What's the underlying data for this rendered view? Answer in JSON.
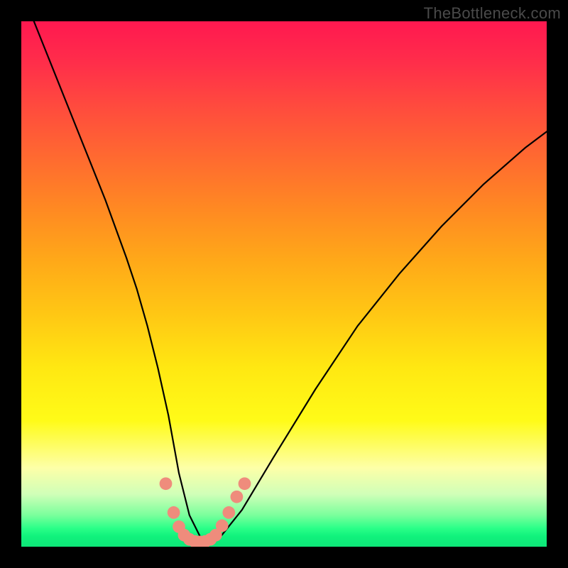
{
  "watermark": "TheBottleneck.com",
  "chart_data": {
    "type": "line",
    "title": "",
    "xlabel": "",
    "ylabel": "",
    "xlim": [
      0,
      100
    ],
    "ylim": [
      0,
      100
    ],
    "grid": false,
    "legend": false,
    "background_gradient": {
      "top": "#ff1850",
      "upper_mid": "#ff8a22",
      "mid": "#ffe812",
      "lower_mid": "#fdffa8",
      "bottom": "#0ee678"
    },
    "series": [
      {
        "name": "bottleneck-curve",
        "color": "#000000",
        "x": [
          0,
          4,
          8,
          12,
          16,
          20,
          22,
          24,
          26,
          28,
          30,
          32,
          34,
          36,
          38,
          42,
          48,
          56,
          64,
          72,
          80,
          88,
          96,
          100
        ],
        "values": [
          106,
          96,
          86,
          76,
          66,
          55,
          49,
          42,
          34,
          25,
          14,
          6,
          2,
          1,
          2,
          7,
          17,
          30,
          42,
          52,
          61,
          69,
          76,
          79
        ]
      }
    ],
    "markers": {
      "name": "threshold-dots",
      "color": "#ef8c7c",
      "radius": 1.2,
      "points": [
        {
          "x": 27.5,
          "y": 12.0
        },
        {
          "x": 29.0,
          "y": 6.5
        },
        {
          "x": 30.0,
          "y": 3.8
        },
        {
          "x": 31.0,
          "y": 2.2
        },
        {
          "x": 32.0,
          "y": 1.4
        },
        {
          "x": 33.0,
          "y": 1.0
        },
        {
          "x": 34.0,
          "y": 0.9
        },
        {
          "x": 35.0,
          "y": 1.0
        },
        {
          "x": 36.0,
          "y": 1.4
        },
        {
          "x": 37.0,
          "y": 2.2
        },
        {
          "x": 38.2,
          "y": 4.0
        },
        {
          "x": 39.5,
          "y": 6.5
        },
        {
          "x": 41.0,
          "y": 9.5
        },
        {
          "x": 42.5,
          "y": 12.0
        }
      ]
    }
  }
}
